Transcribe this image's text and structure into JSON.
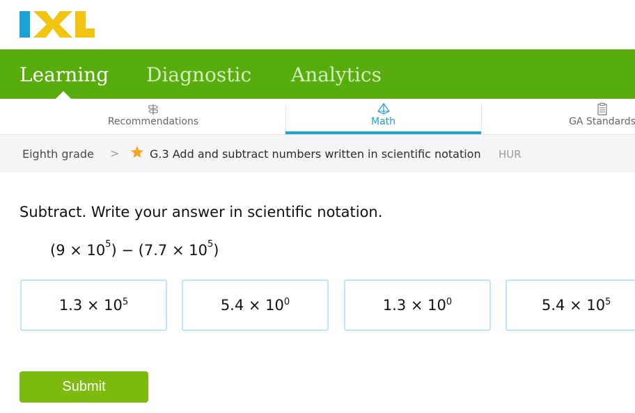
{
  "brand": {
    "logo_text": "IXL",
    "blue": "#1aa2d4",
    "yellow": "#f2c311",
    "green": "#56ad0c"
  },
  "topnav": {
    "items": [
      {
        "label": "Learning",
        "active": true
      },
      {
        "label": "Diagnostic",
        "active": false
      },
      {
        "label": "Analytics",
        "active": false
      }
    ]
  },
  "subtabs": [
    {
      "label": "Recommendations",
      "icon": "signpost-icon",
      "active": false
    },
    {
      "label": "Math",
      "icon": "pyramid-icon",
      "active": true
    },
    {
      "label": "GA Standards",
      "icon": "clipboard-icon",
      "active": false
    }
  ],
  "breadcrumb": {
    "grade": "Eighth grade",
    "separator": ">",
    "skill": "G.3 Add and subtract numbers written in scientific notation",
    "code": "HUR"
  },
  "question": {
    "prompt": "Subtract. Write your answer in scientific notation.",
    "expression": {
      "a_mantissa": "9",
      "a_exp": "5",
      "b_mantissa": "7.7",
      "b_exp": "5"
    }
  },
  "choices": [
    {
      "mantissa": "1.3",
      "exponent": "5"
    },
    {
      "mantissa": "5.4",
      "exponent": "0"
    },
    {
      "mantissa": "1.3",
      "exponent": "0"
    },
    {
      "mantissa": "5.4",
      "exponent": "5"
    }
  ],
  "submit_label": "Submit"
}
